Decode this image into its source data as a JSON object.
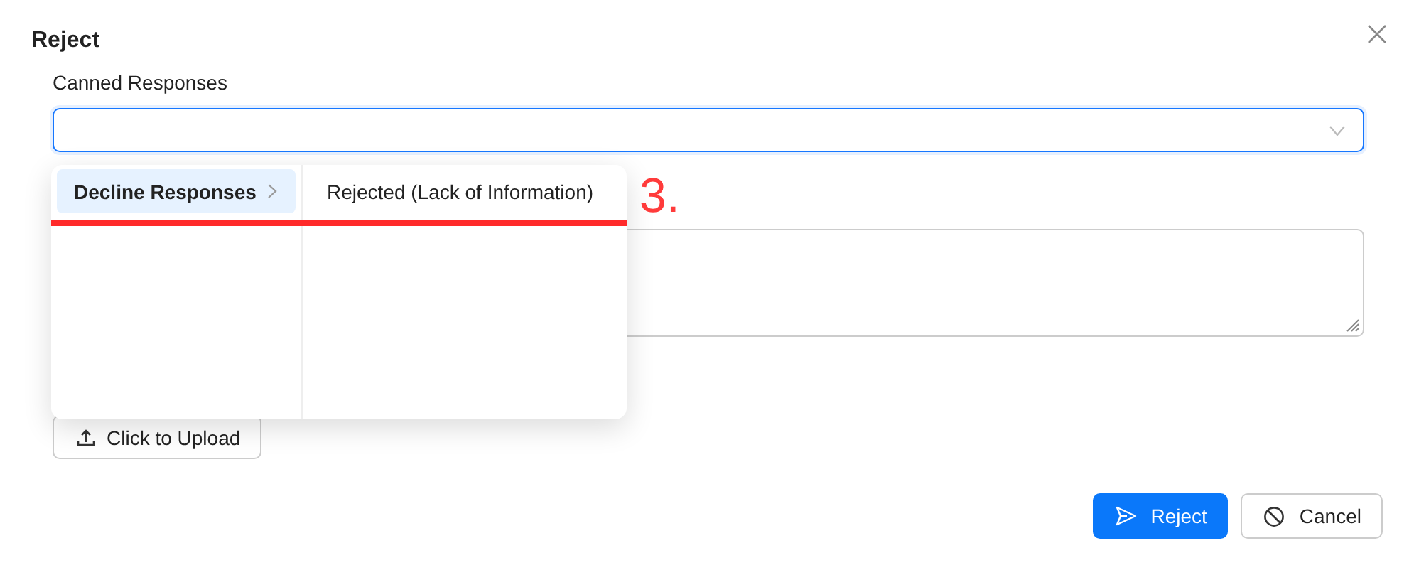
{
  "dialog": {
    "title": "Reject"
  },
  "canned_responses": {
    "label": "Canned Responses",
    "focused": true,
    "expanded": true
  },
  "cascader": {
    "columns": [
      {
        "items": [
          {
            "label": "Decline Responses",
            "selected": true,
            "has_children": true
          }
        ]
      },
      {
        "items": [
          {
            "label": "Rejected (Lack of Information)",
            "selected": false,
            "has_children": false
          }
        ]
      }
    ]
  },
  "upload_button": {
    "label": "Click to Upload"
  },
  "buttons": [
    {
      "label": "Reject",
      "kind": "primary"
    },
    {
      "label": "Cancel",
      "kind": "default"
    }
  ],
  "annotation": {
    "label": "3."
  }
}
